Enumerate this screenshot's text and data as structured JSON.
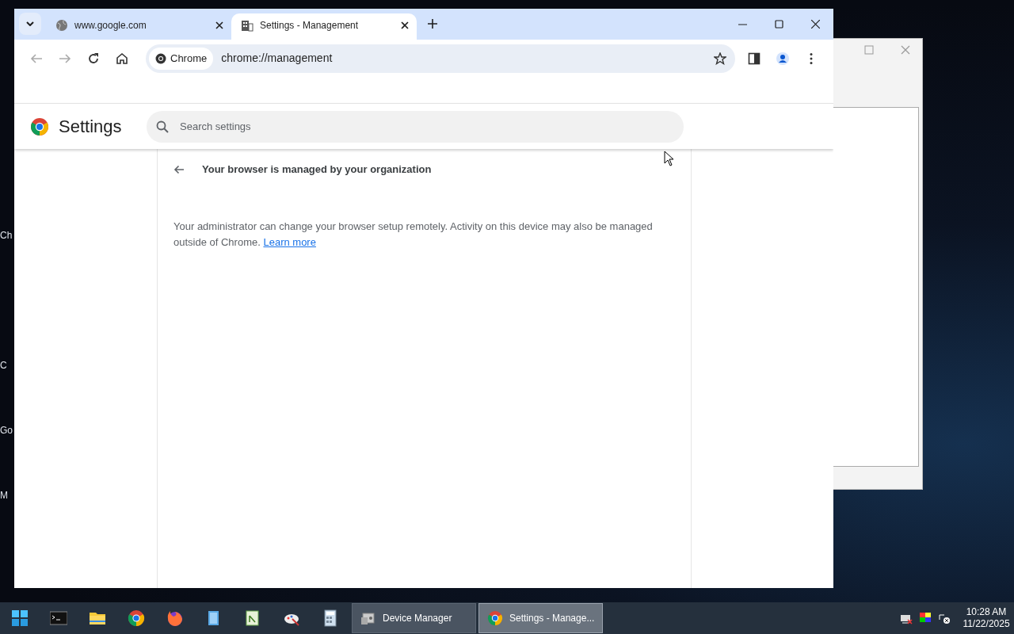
{
  "desktop_icons": [
    {
      "label": "Ch"
    },
    {
      "label": "C"
    },
    {
      "label": "Go"
    },
    {
      "label": "M"
    }
  ],
  "browser": {
    "tabs": [
      {
        "title": "www.google.com",
        "selected": false
      },
      {
        "title": "Settings - Management",
        "selected": true
      }
    ],
    "toolbar": {
      "chip": "Chrome",
      "url": "chrome://management"
    },
    "settings": {
      "title": "Settings",
      "search": {
        "placeholder": "Search settings"
      }
    },
    "page": {
      "heading": "Your browser is managed by your organization",
      "text": "Your administrator can change your browser setup remotely. Activity on this device may also be managed outside of Chrome.",
      "link": "Learn more"
    }
  },
  "taskbar": {
    "windows": [
      {
        "label": "Device Manager",
        "selected": false
      },
      {
        "label": "Settings - Manage...",
        "selected": true
      }
    ],
    "time": "10:28 AM",
    "date": "11/22/2025"
  }
}
